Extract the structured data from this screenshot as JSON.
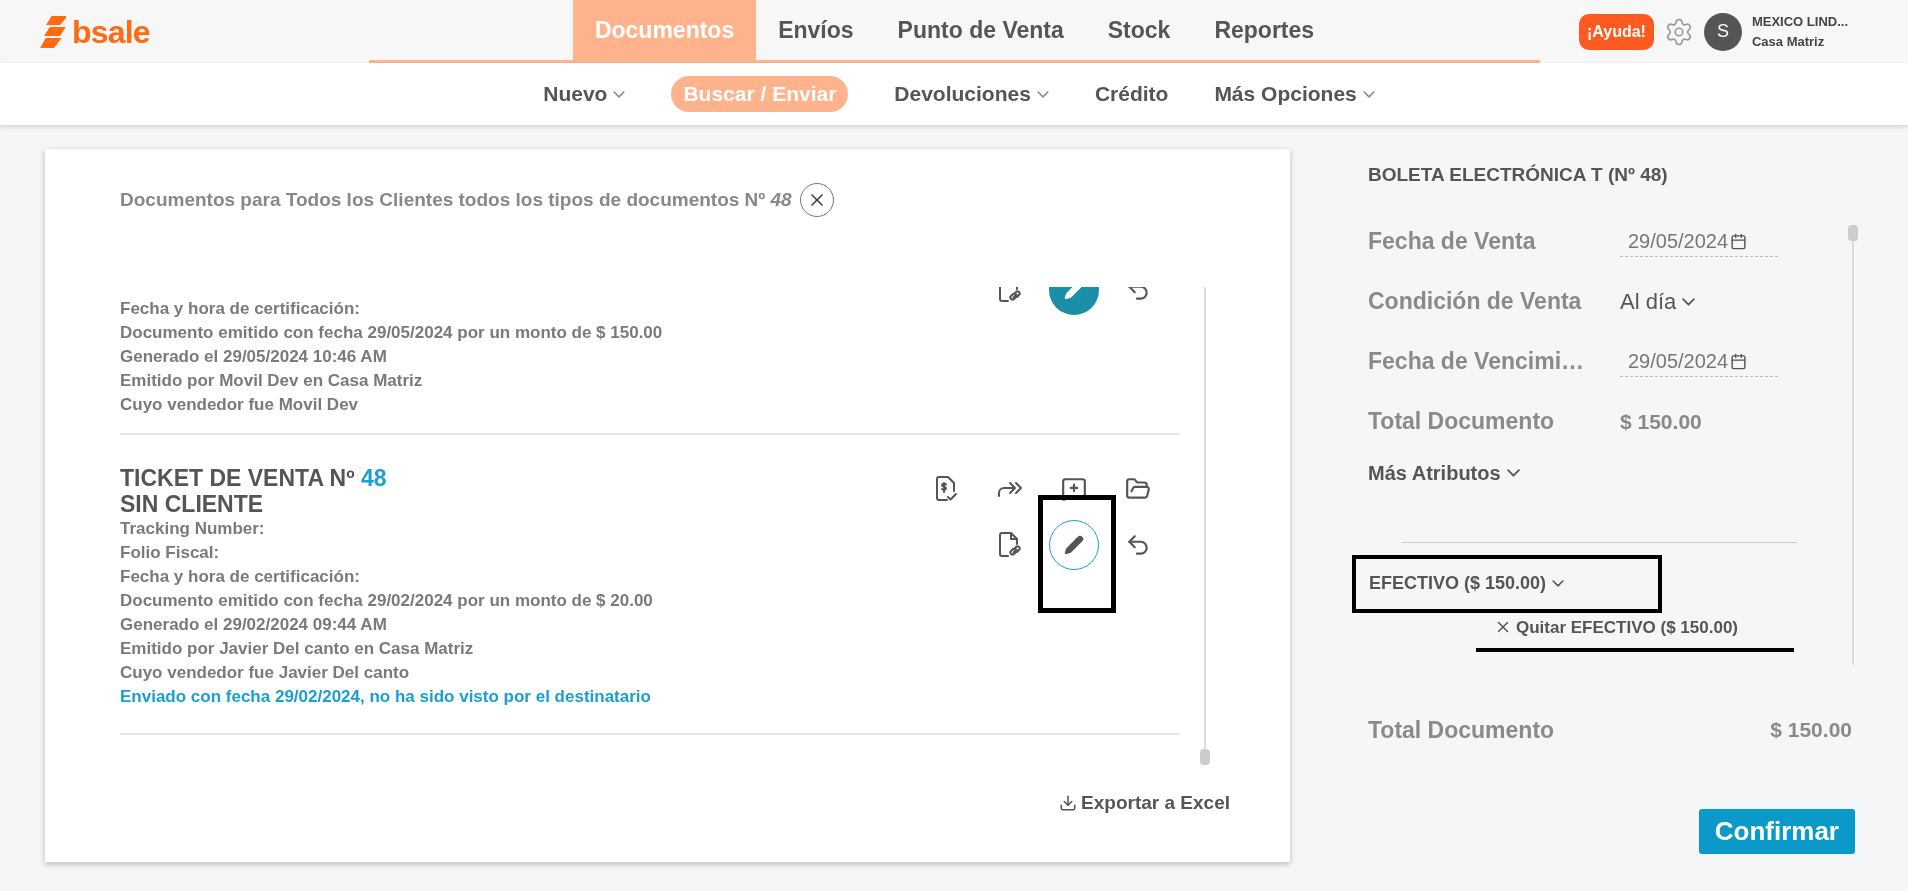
{
  "logo": {
    "text": "bsale"
  },
  "top_nav": [
    {
      "label": "Documentos",
      "selected": true
    },
    {
      "label": "Envíos",
      "selected": false
    },
    {
      "label": "Punto de Venta",
      "selected": false
    },
    {
      "label": "Stock",
      "selected": false
    },
    {
      "label": "Reportes",
      "selected": false
    }
  ],
  "help_button": "¡Ayuda!",
  "user": {
    "initial": "S",
    "name": "MEXICO LIND...",
    "branch": "Casa Matriz"
  },
  "sub_nav": [
    {
      "label": "Nuevo",
      "dropdown": true,
      "selected": false
    },
    {
      "label": "Buscar / Enviar",
      "dropdown": false,
      "selected": true
    },
    {
      "label": "Devoluciones",
      "dropdown": true,
      "selected": false
    },
    {
      "label": "Crédito",
      "dropdown": false,
      "selected": false
    },
    {
      "label": "Más Opciones",
      "dropdown": true,
      "selected": false
    }
  ],
  "search_panel": {
    "title": "Documentos para Todos los Clientes todos los tipos de documentos Nº *48*",
    "documents": [
      {
        "lines": [
          "Fecha y hora de certificación:",
          "Documento emitido con fecha 29/05/2024 por un monto de $ 150.00",
          "Generado el 29/05/2024 10:46 AM",
          "Emitido por Movil Dev en Casa Matriz",
          "Cuyo vendedor fue Movil Dev"
        ],
        "action_rows": [
          {
            "actions": [
              {
                "kind": "file-link",
                "active": false,
                "annotated": false
              },
              {
                "kind": "edit",
                "active": true,
                "annotated": false
              },
              {
                "kind": "undo",
                "active": false,
                "annotated": false
              }
            ]
          }
        ]
      },
      {
        "title": "TICKET DE VENTA Nº",
        "number": "48",
        "client": "SIN CLIENTE",
        "lines": [
          "Tracking Number:",
          "Folio Fiscal:",
          "Fecha y hora de certificación:",
          "Documento emitido con fecha 29/02/2024 por un monto de $ 20.00",
          "Generado el 29/02/2024 09:44 AM",
          "Emitido por Javier Del canto en Casa Matriz",
          "Cuyo vendedor fue Javier Del canto"
        ],
        "sent_notice": "Enviado con fecha 29/02/2024, no ha sido visto por el destinatario",
        "action_rows": [
          {
            "actions": [
              {
                "kind": "receipt",
                "active": false,
                "annotated": false
              },
              {
                "kind": "forward",
                "active": false,
                "annotated": false
              },
              {
                "kind": "comment",
                "active": false,
                "annotated": false
              },
              {
                "kind": "folder",
                "active": false,
                "annotated": false
              }
            ]
          },
          {
            "actions": [
              {
                "kind": "file-link",
                "active": false,
                "annotated": false
              },
              {
                "kind": "edit",
                "active": false,
                "annotated": true
              },
              {
                "kind": "undo",
                "active": false,
                "annotated": false
              }
            ]
          }
        ]
      }
    ],
    "export_link": "Exportar a Excel"
  },
  "sale_panel": {
    "title": "BOLETA ELECTRÓNICA T (Nº 48)",
    "fields": [
      {
        "label": "Fecha de Venta",
        "kind": "date",
        "value": "29/05/2024"
      },
      {
        "label": "Condición de Venta",
        "kind": "select",
        "value": "Al día"
      },
      {
        "label": "Fecha de Vencimi…",
        "kind": "date",
        "value": "29/05/2024"
      },
      {
        "label": "Total Documento",
        "kind": "text",
        "value": "$ 150.00"
      }
    ],
    "more_attributes": "Más Atributos",
    "payment": {
      "label": "EFECTIVO ($ 150.00)",
      "annotated": true
    },
    "remove_payment": {
      "label": "Quitar EFECTIVO ($ 150.00)",
      "annotated": true
    },
    "total": {
      "label": "Total Documento",
      "value": "$ 150.00"
    },
    "confirm_button": "Confirmar"
  }
}
